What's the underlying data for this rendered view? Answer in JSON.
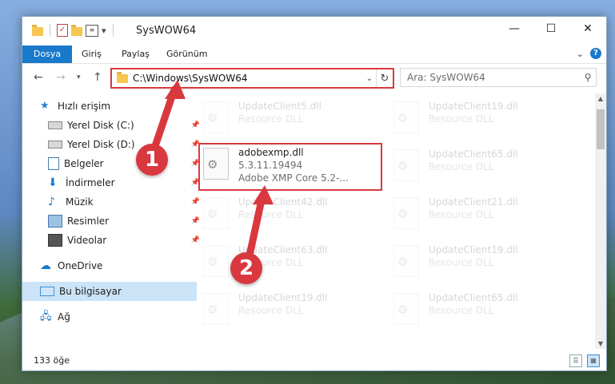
{
  "window": {
    "title": "SysWOW64"
  },
  "ribbon": {
    "tabs": [
      "Dosya",
      "Giriş",
      "Paylaş",
      "Görünüm"
    ]
  },
  "address": {
    "path": "C:\\Windows\\SysWOW64"
  },
  "search": {
    "placeholder": "Ara: SysWOW64"
  },
  "sidebar": {
    "items": [
      {
        "label": "Hızlı erişim",
        "icon": "star-icon"
      },
      {
        "label": "Yerel Disk (C:)",
        "icon": "drive-icon",
        "pinned": true
      },
      {
        "label": "Yerel Disk (D:)",
        "icon": "drive-icon",
        "pinned": true
      },
      {
        "label": "Belgeler",
        "icon": "documents-icon",
        "pinned": true
      },
      {
        "label": "İndirmeler",
        "icon": "downloads-icon",
        "pinned": true
      },
      {
        "label": "Müzik",
        "icon": "music-icon",
        "pinned": true
      },
      {
        "label": "Resimler",
        "icon": "pictures-icon",
        "pinned": true
      },
      {
        "label": "Videolar",
        "icon": "videos-icon",
        "pinned": true
      },
      {
        "label": "OneDrive",
        "icon": "cloud-icon"
      },
      {
        "label": "Bu bilgisayar",
        "icon": "computer-icon",
        "selected": true
      },
      {
        "label": "Ağ",
        "icon": "network-icon"
      }
    ]
  },
  "files": {
    "left": [
      {
        "name": "UpdateClient5.dll",
        "type": "Resource DLL"
      },
      {
        "name": "adobexmp.dll",
        "version": "5.3.11.19494",
        "desc": "Adobe XMP Core 5.2-..."
      },
      {
        "name": "UpdateClient42.dll",
        "type": "Resource DLL"
      },
      {
        "name": "UpdateClient63.dll",
        "type": "Resource DLL"
      },
      {
        "name": "UpdateClient19.dll",
        "type": "Resource DLL"
      }
    ],
    "right": [
      {
        "name": "UpdateClient19.dll",
        "type": "Resource DLL"
      },
      {
        "name": "UpdateClient65.dll",
        "type": "Resource DLL"
      },
      {
        "name": "UpdateClient21.dll",
        "type": "Resource DLL"
      },
      {
        "name": "UpdateClient19.dll",
        "type": "Resource DLL"
      },
      {
        "name": "UpdateClient65.dll",
        "type": "Resource DLL"
      }
    ]
  },
  "status": {
    "count": "133 öğe"
  },
  "callouts": [
    "1",
    "2"
  ],
  "colors": {
    "accent": "#1979ca",
    "highlight": "#d9383e",
    "selected": "#cce4f7"
  }
}
